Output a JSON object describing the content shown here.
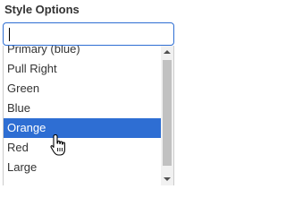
{
  "field": {
    "label": "Style Options",
    "search_value": ""
  },
  "options": [
    {
      "label": "Primary (blue)"
    },
    {
      "label": "Pull Right"
    },
    {
      "label": "Green"
    },
    {
      "label": "Blue"
    },
    {
      "label": "Orange",
      "highlighted": true
    },
    {
      "label": "Red"
    },
    {
      "label": "Large"
    }
  ],
  "colors": {
    "accent": "#2e6ed3",
    "text": "#333333",
    "scroll_track": "#f1f1f1",
    "scroll_thumb": "#c1c1c1"
  },
  "icons": {
    "cursor": "hand-pointer-icon",
    "scroll_up": "arrow-up-icon",
    "scroll_down": "arrow-down-icon"
  }
}
